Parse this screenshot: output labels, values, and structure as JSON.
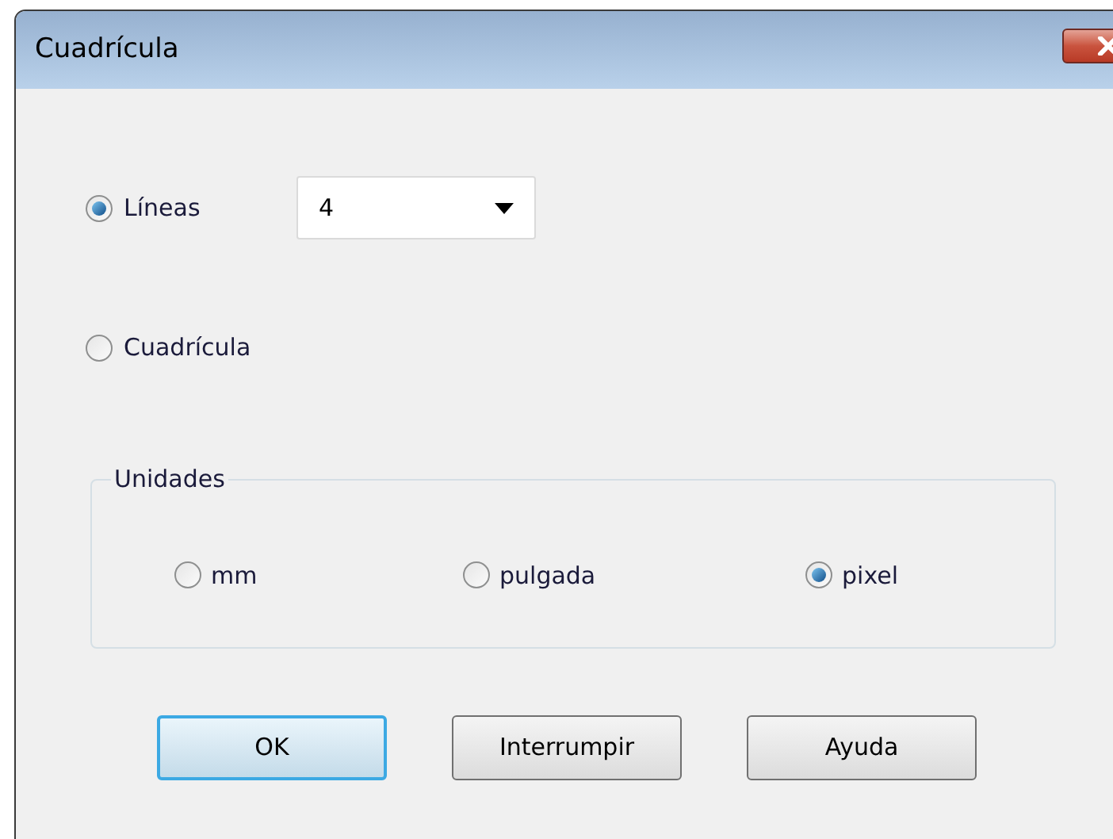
{
  "window": {
    "title": "Cuadrícula"
  },
  "mode_options": [
    {
      "label": "Líneas",
      "selected": true,
      "dropdown": {
        "value": "4"
      }
    },
    {
      "label": "Cuadrícula",
      "selected": false
    }
  ],
  "units": {
    "title": "Unidades",
    "options": [
      {
        "label": "mm",
        "selected": false
      },
      {
        "label": "pulgada",
        "selected": false
      },
      {
        "label": "pixel",
        "selected": true
      }
    ]
  },
  "buttons": [
    {
      "label": "OK",
      "default": true
    },
    {
      "label": "Interrumpir",
      "default": false
    },
    {
      "label": "Ayuda",
      "default": false
    }
  ]
}
